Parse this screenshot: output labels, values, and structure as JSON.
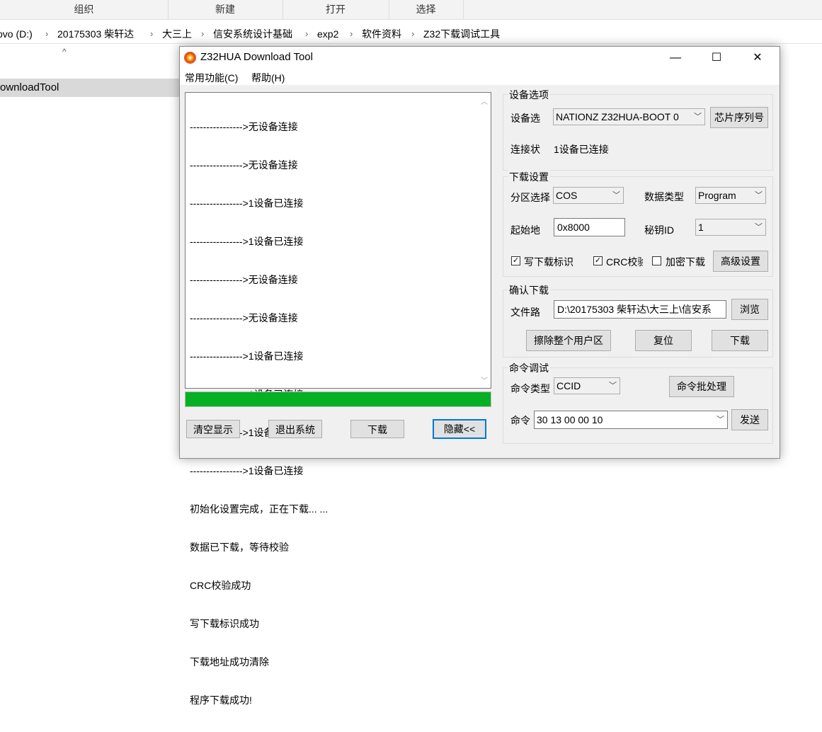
{
  "explorer": {
    "ribbon_groups": [
      "组织",
      "新建",
      "打开",
      "选择"
    ],
    "breadcrumb": [
      "ovo (D:)",
      "20175303 柴轩达",
      "大三上",
      "信安系统设计基础",
      "exp2",
      "软件资料",
      "Z32下载调试工具"
    ],
    "sort_glyph": "^",
    "selected_file": "ownloadTool"
  },
  "dialog": {
    "title": "Z32HUA Download Tool",
    "window_buttons": {
      "minimize": "—",
      "maximize": "☐",
      "close": "✕"
    },
    "menu": [
      "常用功能(C)",
      "帮助(H)"
    ],
    "log_lines": [
      "---------------->无设备连接",
      "---------------->无设备连接",
      "---------------->1设备已连接",
      "---------------->1设备已连接",
      "---------------->无设备连接",
      "---------------->无设备连接",
      "---------------->1设备已连接",
      "---------------->1设备已连接",
      "---------------->1设备已连接",
      "---------------->1设备已连接",
      "初始化设置完成，正在下载... ...",
      "数据已下载，等待校验",
      "CRC校验成功",
      "写下载标识成功",
      "下载地址成功清除",
      "程序下载成功!"
    ],
    "progress": 1.0,
    "progress_color": "#06b025",
    "bottom_buttons": {
      "clear": "清空显示",
      "exit": "退出系统",
      "download": "下载",
      "hide": "隐藏<<"
    },
    "device": {
      "group_label": "设备选项",
      "select_label": "设备选",
      "select_value": "NATIONZ Z32HUA-BOOT 0",
      "chip_serial_button": "芯片序列号",
      "status_label": "连接状",
      "status_value": "1设备已连接"
    },
    "download_settings": {
      "group_label": "下载设置",
      "partition_label": "分区选择",
      "partition_value": "COS",
      "data_type_label": "数据类型",
      "data_type_value": "Program",
      "start_addr_label": "起始地",
      "start_addr_value": "0x8000",
      "key_id_label": "秘钥ID",
      "key_id_value": "1",
      "check_write_flag": "写下载标识",
      "check_crc": "CRC校验",
      "check_encrypt": "加密下载",
      "write_flag_checked": true,
      "crc_checked": true,
      "encrypt_checked": false,
      "advanced_button": "高级设置"
    },
    "confirm_download": {
      "group_label": "确认下载",
      "file_path_label": "文件路",
      "file_path_value": "D:\\20175303 柴轩达\\大三上\\信安系",
      "browse_button": "浏览",
      "erase_button": "擦除整个用户区",
      "reset_button": "复位",
      "download_button": "下载"
    },
    "command_debug": {
      "group_label": "命令调试",
      "type_label": "命令类型",
      "type_value": "CCID",
      "batch_button": "命令批处理",
      "cmd_label": "命令",
      "cmd_value": "30 13 00 00 10",
      "send_button": "发送"
    }
  }
}
